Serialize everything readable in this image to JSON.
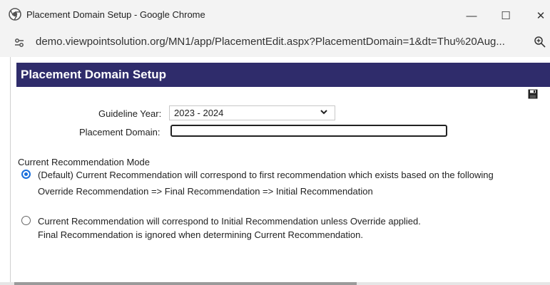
{
  "window": {
    "title": "Placement Domain Setup - Google Chrome",
    "minimize_label": "—",
    "maximize_label": "☐",
    "close_label": "✕"
  },
  "address_bar": {
    "url": "demo.viewpointsolution.org/MN1/app/PlacementEdit.aspx?PlacementDomain=1&dt=Thu%20Aug...",
    "site_icon": "tune-icon",
    "zoom_icon": "zoom-icon"
  },
  "page": {
    "header_title": "Placement Domain Setup",
    "header_color": "#2f2c6b",
    "save_icon": "save-icon",
    "guideline_year_label": "Guideline Year:",
    "guideline_year_value": "2023 - 2024",
    "placement_domain_label": "Placement Domain:",
    "placement_domain_value": "",
    "mode_heading": "Current Recommendation Mode",
    "options": [
      {
        "selected": true,
        "line1": "(Default) Current Recommendation will correspond to first recommendation which exists based on the following",
        "line2": "Override Recommendation => Final Recommendation => Initial Recommendation"
      },
      {
        "selected": false,
        "line1": "Current Recommendation will correspond to Initial Recommendation unless Override applied.",
        "line2": "Final Recommendation is ignored when determining Current Recommendation."
      }
    ],
    "radio_color": "#1a6fdc"
  }
}
